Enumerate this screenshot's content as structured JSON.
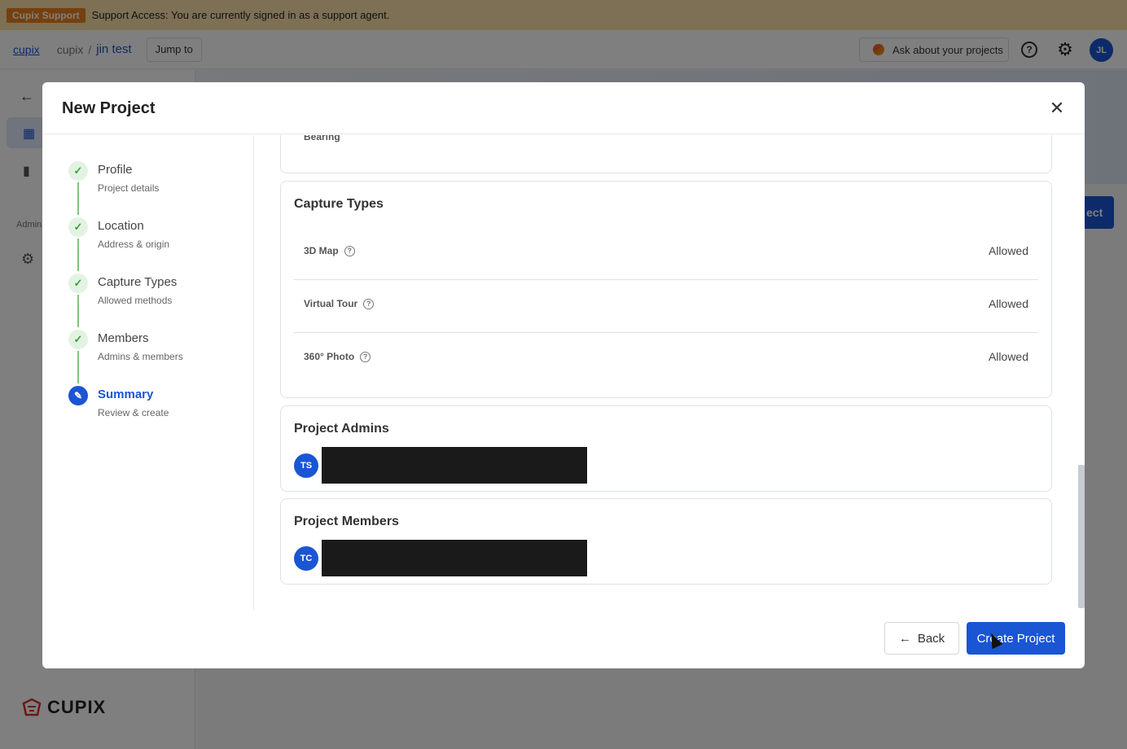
{
  "banner": {
    "badge": "Cupix Support",
    "message": "Support Access: You are currently signed in as a support agent."
  },
  "header": {
    "brand": "cupix",
    "breadcrumb": {
      "org": "cupix",
      "separator": "/",
      "project": "jin test"
    },
    "jump_label": "Jump to",
    "ask_label": "Ask about your projects",
    "avatar_initials": "JL"
  },
  "sidebar": {
    "admin_label": "Admin",
    "logo_text": "CUPIX"
  },
  "background": {
    "create_label": "ect"
  },
  "modal": {
    "title": "New Project",
    "steps": [
      {
        "title": "Profile",
        "subtitle": "Project details",
        "state": "complete"
      },
      {
        "title": "Location",
        "subtitle": "Address & origin",
        "state": "complete"
      },
      {
        "title": "Capture Types",
        "subtitle": "Allowed methods",
        "state": "complete"
      },
      {
        "title": "Members",
        "subtitle": "Admins & members",
        "state": "complete"
      },
      {
        "title": "Summary",
        "subtitle": "Review & create",
        "state": "active"
      }
    ],
    "partial_field_label": "Bearing",
    "capture_types": {
      "title": "Capture Types",
      "rows": [
        {
          "label": "3D Map",
          "status": "Allowed"
        },
        {
          "label": "Virtual Tour",
          "status": "Allowed"
        },
        {
          "label": "360° Photo",
          "status": "Allowed"
        }
      ]
    },
    "admins": {
      "title": "Project Admins",
      "initials": "TS"
    },
    "members": {
      "title": "Project Members",
      "initials": "TC"
    },
    "back_label": "Back",
    "create_label": "Create Project"
  },
  "colors": {
    "primary": "#1a55d4",
    "complete": "#7cc77c",
    "banner": "#fbe0a9",
    "badge": "#e8801e"
  }
}
